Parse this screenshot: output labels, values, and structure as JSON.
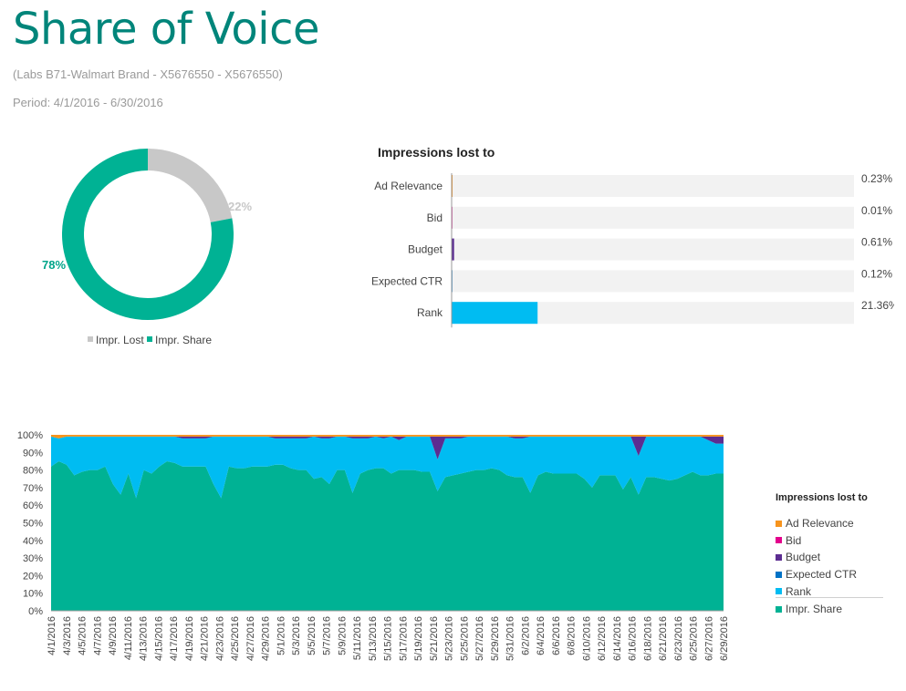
{
  "header": {
    "title": "Share of Voice",
    "subtitle": "(Labs B71-Walmart Brand - X5676550 - X5676550)",
    "period": "Period: 4/1/2016 - 6/30/2016"
  },
  "colors": {
    "impr_share": "#00b294",
    "impr_lost": "#c8c8c8",
    "ad_relevance": "#f7941d",
    "bid": "#e3008c",
    "budget": "#5c2d91",
    "expected_ctr": "#0072c6",
    "rank": "#00bcf2",
    "track": "#f2f2f2"
  },
  "chart_data": [
    {
      "type": "pie",
      "slices": [
        {
          "label": "Impr. Lost",
          "value": 22,
          "display": "22%"
        },
        {
          "label": "Impr. Share",
          "value": 78,
          "display": "78%"
        }
      ],
      "legend": [
        "Impr. Lost",
        "Impr. Share"
      ],
      "legend_position": "bottom"
    },
    {
      "type": "bar",
      "orientation": "horizontal",
      "title": "Impressions lost to",
      "categories": [
        "Ad Relevance",
        "Bid",
        "Budget",
        "Expected CTR",
        "Rank"
      ],
      "values": [
        0.23,
        0.01,
        0.61,
        0.12,
        21.36
      ],
      "labels": [
        "0.23%",
        "0.01%",
        "0.61%",
        "0.12%",
        "21.36%"
      ],
      "xlim": [
        0,
        100
      ]
    },
    {
      "type": "area",
      "stacked": true,
      "ylim": [
        0,
        100
      ],
      "yticks": [
        "0%",
        "10%",
        "20%",
        "30%",
        "40%",
        "50%",
        "60%",
        "70%",
        "80%",
        "90%",
        "100%"
      ],
      "x_tick_labels": [
        "4/1/2016",
        "4/3/2016",
        "4/5/2016",
        "4/7/2016",
        "4/9/2016",
        "4/11/2016",
        "4/13/2016",
        "4/15/2016",
        "4/17/2016",
        "4/19/2016",
        "4/21/2016",
        "4/23/2016",
        "4/25/2016",
        "4/27/2016",
        "4/29/2016",
        "5/1/2016",
        "5/3/2016",
        "5/5/2016",
        "5/7/2016",
        "5/9/2016",
        "5/11/2016",
        "5/13/2016",
        "5/15/2016",
        "5/17/2016",
        "5/19/2016",
        "5/21/2016",
        "5/23/2016",
        "5/25/2016",
        "5/27/2016",
        "5/29/2016",
        "5/31/2016",
        "6/2/2016",
        "6/4/2016",
        "6/6/2016",
        "6/8/2016",
        "6/10/2016",
        "6/12/2016",
        "6/14/2016",
        "6/16/2016",
        "6/18/2016",
        "6/21/2016",
        "6/23/2016",
        "6/25/2016",
        "6/27/2016",
        "6/29/2016"
      ],
      "legend_title": "Impressions lost to",
      "legend_position": "right",
      "series": [
        {
          "name": "Impr. Share",
          "values": [
            82,
            85,
            83,
            77,
            79,
            80,
            80,
            82,
            72,
            66,
            78,
            64,
            80,
            78,
            82,
            85,
            84,
            82,
            82,
            82,
            82,
            72,
            64,
            82,
            81,
            81,
            82,
            82,
            82,
            83,
            83,
            81,
            80,
            80,
            75,
            76,
            72,
            80,
            80,
            67,
            78,
            80,
            81,
            81,
            78,
            80,
            80,
            80,
            79,
            79,
            68,
            76,
            77,
            78,
            79,
            80,
            80,
            81,
            80,
            77,
            76,
            76,
            67,
            77,
            79,
            78,
            78,
            78,
            78,
            75,
            70,
            77,
            77,
            77,
            69,
            76,
            66,
            76,
            76,
            75,
            74,
            75,
            77,
            79,
            77,
            77,
            78,
            78
          ]
        },
        {
          "name": "Rank",
          "values": [
            17,
            13,
            16,
            22,
            20,
            19,
            19,
            17,
            27,
            33,
            21,
            35,
            19,
            21,
            17,
            14,
            15,
            16,
            16,
            16,
            16,
            27,
            35,
            17,
            18,
            18,
            17,
            17,
            17,
            15,
            15,
            17,
            18,
            18,
            24,
            22,
            26,
            19,
            19,
            31,
            20,
            18,
            18,
            17,
            21,
            17,
            19,
            19,
            20,
            20,
            18,
            22,
            21,
            20,
            20,
            19,
            19,
            18,
            19,
            22,
            22,
            22,
            32,
            22,
            20,
            21,
            21,
            21,
            21,
            24,
            29,
            22,
            22,
            22,
            30,
            23,
            22,
            23,
            23,
            24,
            25,
            24,
            22,
            20,
            22,
            20,
            17,
            17
          ]
        },
        {
          "name": "Budget",
          "values": [
            0,
            0,
            0,
            0,
            0,
            0,
            0,
            0,
            0,
            0,
            0,
            0,
            0,
            0,
            0,
            0,
            0,
            1,
            1,
            1,
            1,
            0,
            0,
            0,
            0,
            0,
            0,
            0,
            0,
            1,
            1,
            1,
            1,
            1,
            0,
            1,
            1,
            0,
            0,
            1,
            1,
            1,
            0,
            1,
            0,
            2,
            0,
            0,
            0,
            0,
            13,
            1,
            1,
            1,
            0,
            0,
            0,
            0,
            0,
            0,
            1,
            1,
            0,
            0,
            0,
            0,
            0,
            0,
            0,
            0,
            0,
            0,
            0,
            0,
            0,
            0,
            11,
            0,
            0,
            0,
            0,
            0,
            0,
            0,
            0,
            2,
            4,
            4
          ]
        },
        {
          "name": "Expected CTR",
          "values": [
            0,
            0,
            0,
            0,
            0,
            0,
            0,
            0,
            0,
            0,
            0,
            0,
            0,
            0,
            0,
            0,
            0,
            0,
            0,
            0,
            0,
            0,
            0,
            0,
            0,
            0,
            0,
            0,
            0,
            0,
            0,
            0,
            0,
            0,
            0,
            0,
            0,
            0,
            0,
            0,
            0,
            0,
            0,
            0,
            0,
            0,
            0,
            0,
            0,
            0,
            0,
            0,
            0,
            0,
            0,
            0,
            0,
            0,
            0,
            0,
            0,
            0,
            0,
            0,
            0,
            0,
            0,
            0,
            0,
            0,
            0,
            0,
            0,
            0,
            0,
            0,
            0,
            0,
            0,
            0,
            0,
            0,
            0,
            0,
            0,
            0,
            0,
            0
          ]
        },
        {
          "name": "Bid",
          "values": [
            0,
            0,
            0,
            0,
            0,
            0,
            0,
            0,
            0,
            0,
            0,
            0,
            0,
            0,
            0,
            0,
            0,
            0,
            0,
            0,
            0,
            0,
            0,
            0,
            0,
            0,
            0,
            0,
            0,
            0,
            0,
            0,
            0,
            0,
            0,
            0,
            0,
            0,
            0,
            0,
            0,
            0,
            0,
            0,
            0,
            0,
            0,
            0,
            0,
            0,
            0,
            0,
            0,
            0,
            0,
            0,
            0,
            0,
            0,
            0,
            0,
            0,
            0,
            0,
            0,
            0,
            0,
            0,
            0,
            0,
            0,
            0,
            0,
            0,
            0,
            0,
            0,
            0,
            0,
            0,
            0,
            0,
            0,
            0,
            0,
            0,
            0,
            0
          ]
        },
        {
          "name": "Ad Relevance",
          "values": [
            1,
            2,
            1,
            1,
            1,
            1,
            1,
            1,
            1,
            1,
            1,
            1,
            1,
            1,
            1,
            1,
            1,
            1,
            1,
            1,
            1,
            1,
            1,
            1,
            1,
            1,
            1,
            1,
            1,
            1,
            1,
            1,
            1,
            1,
            1,
            1,
            1,
            1,
            1,
            1,
            1,
            1,
            1,
            1,
            1,
            1,
            1,
            1,
            1,
            1,
            1,
            1,
            1,
            1,
            1,
            1,
            1,
            1,
            1,
            1,
            1,
            1,
            1,
            1,
            1,
            1,
            1,
            1,
            1,
            1,
            1,
            1,
            1,
            1,
            1,
            1,
            1,
            1,
            1,
            1,
            1,
            1,
            1,
            1,
            1,
            1,
            1,
            1
          ]
        }
      ]
    }
  ]
}
